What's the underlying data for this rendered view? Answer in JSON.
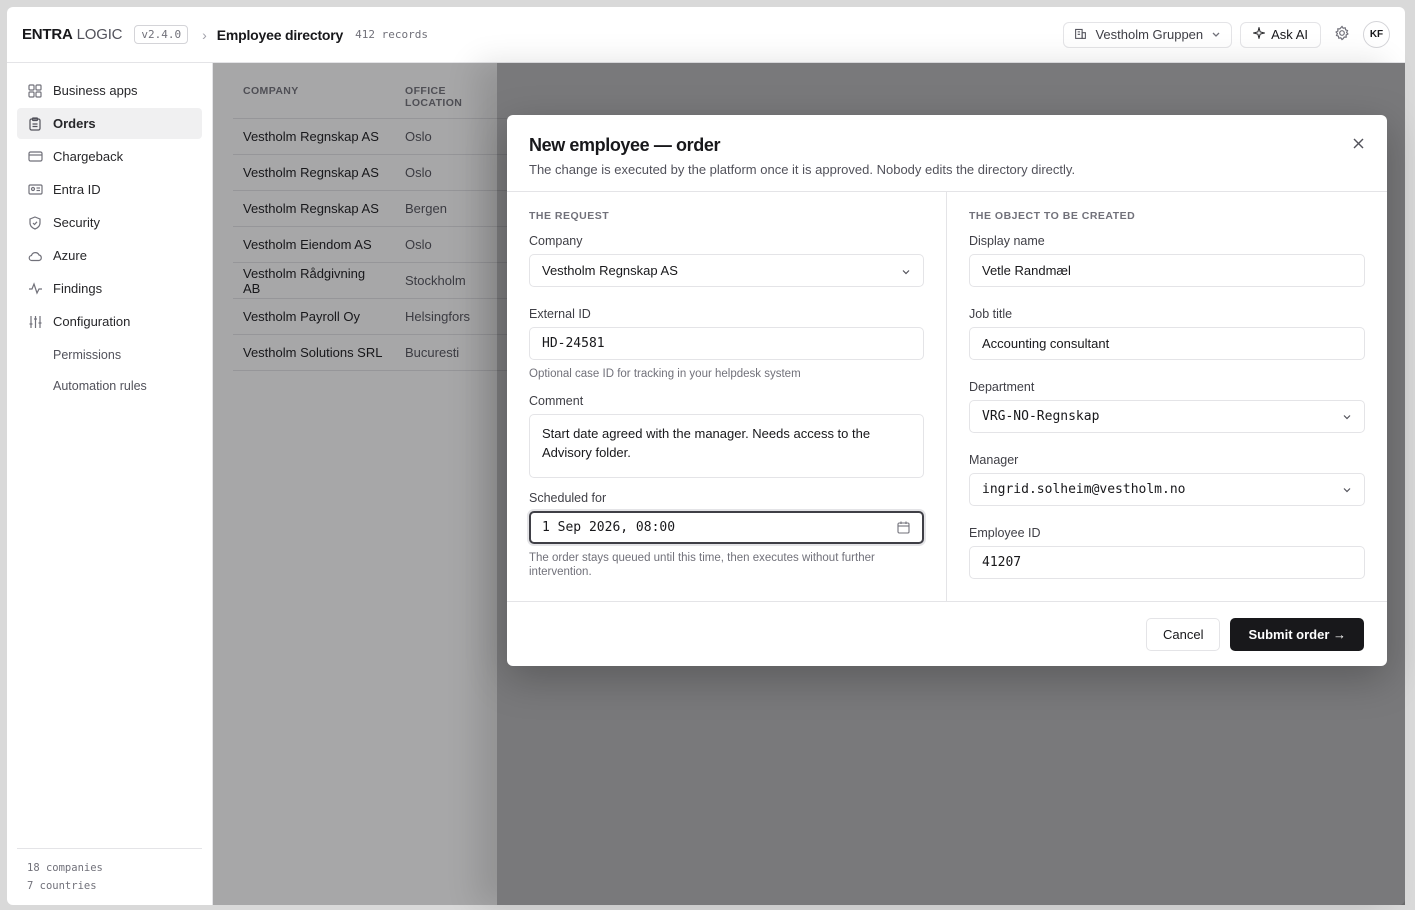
{
  "header": {
    "brand_bold": "ENTRA",
    "brand_light": " LOGIC",
    "version": "v2.4.0",
    "page_title": "Employee directory",
    "record_count": "412 records",
    "tenant": "Vestholm Gruppen",
    "ask_ai": "Ask AI",
    "avatar_initials": "KF"
  },
  "sidebar": {
    "items": [
      {
        "label": "Business apps",
        "icon": "grid-icon"
      },
      {
        "label": "Orders",
        "icon": "clipboard-icon",
        "active": true
      },
      {
        "label": "Chargeback",
        "icon": "credit-card-icon"
      },
      {
        "label": "Entra ID",
        "icon": "id-card-icon"
      },
      {
        "label": "Security",
        "icon": "shield-icon"
      },
      {
        "label": "Azure",
        "icon": "cloud-icon"
      },
      {
        "label": "Findings",
        "icon": "activity-icon"
      },
      {
        "label": "Configuration",
        "icon": "sliders-icon"
      }
    ],
    "sub_items": [
      "Permissions",
      "Automation rules"
    ],
    "footer": {
      "companies": "18 companies",
      "countries": "7 countries"
    }
  },
  "table": {
    "columns": [
      "COMPANY",
      "OFFICE\nLOCATION"
    ],
    "rows": [
      {
        "company": "Vestholm Regnskap AS",
        "location": "Oslo"
      },
      {
        "company": "Vestholm Regnskap AS",
        "location": "Oslo"
      },
      {
        "company": "Vestholm Regnskap AS",
        "location": "Bergen"
      },
      {
        "company": "Vestholm Eiendom AS",
        "location": "Oslo"
      },
      {
        "company": "Vestholm Rådgivning AB",
        "location": "Stockholm"
      },
      {
        "company": "Vestholm Payroll Oy",
        "location": "Helsingfors"
      },
      {
        "company": "Vestholm Solutions SRL",
        "location": "Bucuresti"
      }
    ]
  },
  "modal": {
    "title": "New employee — order",
    "subtitle": "The change is executed by the platform once it is approved. Nobody edits the directory directly.",
    "request": {
      "section": "THE REQUEST",
      "company_label": "Company",
      "company_value": "Vestholm Regnskap AS",
      "external_id_label": "External ID",
      "external_id_value": "HD-24581",
      "external_id_help": "Optional case ID for tracking in your helpdesk system",
      "comment_label": "Comment",
      "comment_value": "Start date agreed with the manager. Needs access to the Advisory folder.",
      "scheduled_label": "Scheduled for",
      "scheduled_value": "1 Sep 2026, 08:00",
      "scheduled_help": "The order stays queued until this time, then executes without further intervention."
    },
    "object": {
      "section": "THE OBJECT TO BE CREATED",
      "display_name_label": "Display name",
      "display_name_value": "Vetle Randmæl",
      "job_title_label": "Job title",
      "job_title_value": "Accounting consultant",
      "department_label": "Department",
      "department_value": "VRG-NO-Regnskap",
      "manager_label": "Manager",
      "manager_value": "ingrid.solheim@vestholm.no",
      "employee_id_label": "Employee ID",
      "employee_id_value": "41207"
    },
    "cancel": "Cancel",
    "submit": "Submit order →"
  }
}
